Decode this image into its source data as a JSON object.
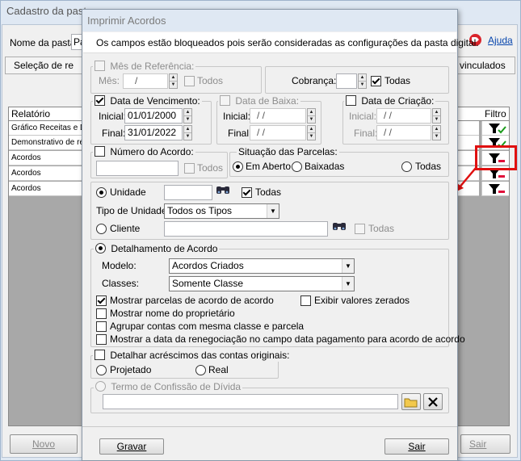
{
  "background": {
    "window_title": "Cadastro da pasta",
    "nome_label": "Nome da pasta:",
    "nome_value": "Pa",
    "help_label": "Ajuda",
    "tab_left": "Seleção de re",
    "tab_right": "vinculados",
    "grid_header": "Relatório",
    "grid_filter_header": "Filtro",
    "rows": [
      "Gráfico Receitas e De",
      "Demonstrativo de re",
      "Acordos",
      "Acordos",
      "Acordos"
    ],
    "novo_label": "Novo",
    "sair_label": "Sair"
  },
  "dialog": {
    "title": "Imprimir Acordos",
    "notice": "Os campos estão bloqueados pois serão consideradas as configurações da pasta digital.",
    "mes_referencia": {
      "legend": "Mês de Referência:",
      "mes_label": "Mês:",
      "mes_value": "/",
      "todos_label": "Todos"
    },
    "cobranca": {
      "label": "Cobrança:",
      "value": "",
      "todos_label": "Todas"
    },
    "vencimento": {
      "legend": "Data de Vencimento:",
      "inicial_label": "Inicial:",
      "inicial_value": "01/01/2000",
      "final_label": "Final:",
      "final_value": "31/01/2022"
    },
    "baixa": {
      "legend": "Data de Baixa:",
      "inicial_label": "Inicial:",
      "inicial_value": "/ /",
      "final_label": "Final:",
      "final_value": "/ /"
    },
    "criacao": {
      "legend": "Data de Criação:",
      "inicial_label": "Inicial:",
      "inicial_value": "/ /",
      "final_label": "Final:",
      "final_value": "/ /"
    },
    "numero_acordo": {
      "legend": "Número do Acordo:",
      "value": "",
      "todos_label": "Todos"
    },
    "situacao": {
      "legend": "Situação das Parcelas:",
      "em_aberto": "Em Aberto",
      "baixadas": "Baixadas",
      "todas": "Todas"
    },
    "unidade": {
      "unidade_label": "Unidade",
      "unidade_value": "",
      "todas_label": "Todas",
      "tipo_label": "Tipo de Unidade:",
      "tipo_value": "Todos os Tipos",
      "cliente_label": "Cliente",
      "cliente_value": "",
      "cliente_todas_label": "Todas"
    },
    "detalhamento": {
      "legend": "Detalhamento de Acordo",
      "modelo_label": "Modelo:",
      "modelo_value": "Acordos Criados",
      "classes_label": "Classes:",
      "classes_value": "Somente Classe",
      "opt_parcelas": "Mostrar parcelas de acordo de acordo",
      "opt_zerados": "Exibir valores zerados",
      "opt_proprietario": "Mostrar nome do proprietário",
      "opt_agrupar": "Agrupar contas com mesma classe e parcela",
      "opt_renegociacao": "Mostrar a data da renegociação no campo data pagamento para acordo de acordo"
    },
    "acrescimos": {
      "legend": "Detalhar acréscimos das contas originais:",
      "projetado": "Projetado",
      "real": "Real"
    },
    "termo": {
      "legend": "Termo de Confissão de Dívida",
      "value": ""
    },
    "gravar_label": "Gravar",
    "sair_label": "Sair"
  }
}
